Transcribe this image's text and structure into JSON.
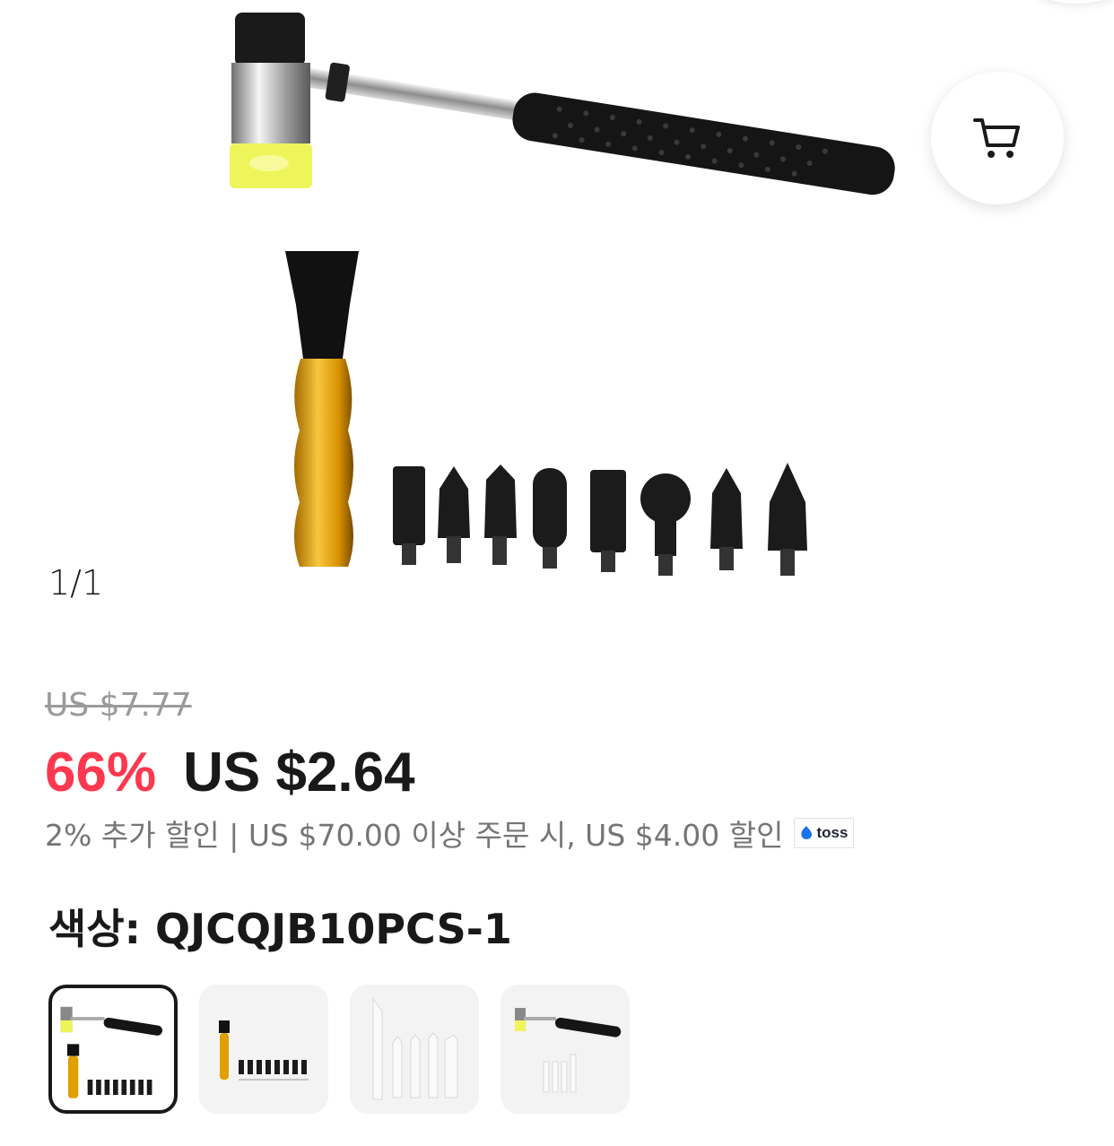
{
  "gallery": {
    "counter": "1/1",
    "cart_icon": "cart-icon"
  },
  "price": {
    "original": "US $7.77",
    "discount": "66%",
    "current": "US $2.64",
    "promo_text": "2% 추가 할인 | US $70.00 이상 주문 시, US $4.00 할인",
    "promo_badge": "toss"
  },
  "variant": {
    "label": "색상: QJCQJB10PCS-1",
    "thumbnails": [
      {
        "name": "variant-thumb-1",
        "selected": true
      },
      {
        "name": "variant-thumb-2",
        "selected": false
      },
      {
        "name": "variant-thumb-3",
        "selected": false
      },
      {
        "name": "variant-thumb-4",
        "selected": false
      }
    ]
  },
  "colors": {
    "discount": "#fd384f",
    "text": "#191919",
    "muted": "#757575",
    "old_price": "#9a9a9a"
  }
}
